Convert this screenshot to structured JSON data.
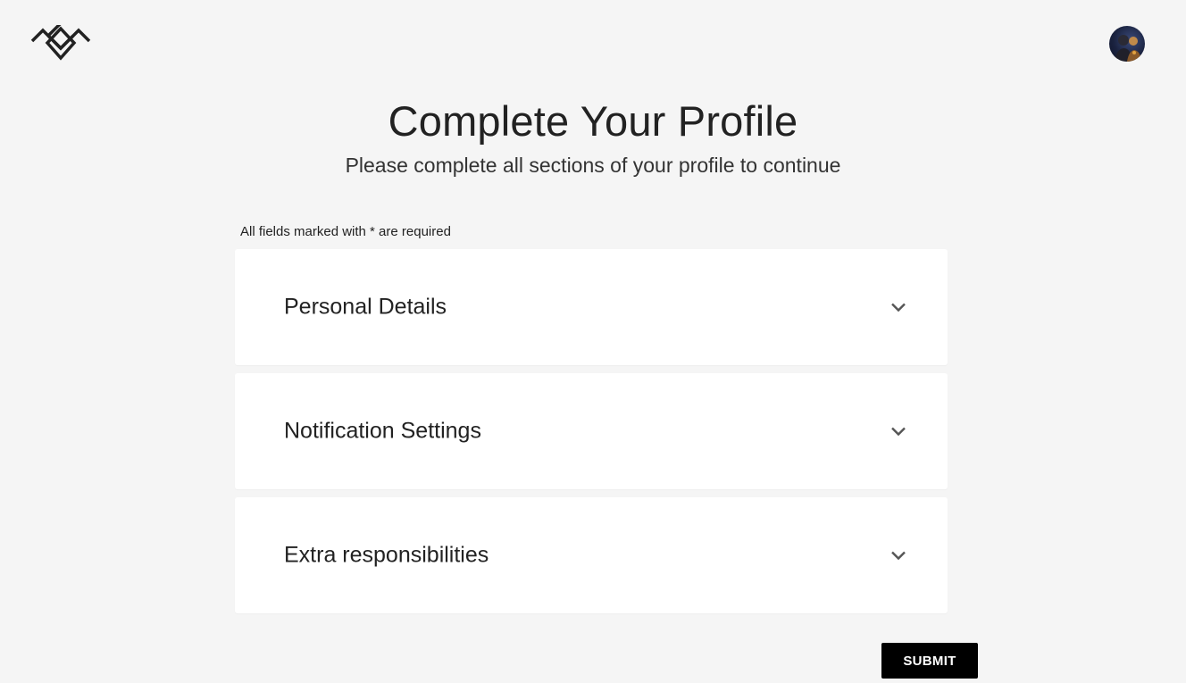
{
  "header": {
    "logo_icon": "mountain-diamond-logo-icon",
    "avatar_icon": "user-avatar-icon"
  },
  "main": {
    "title": "Complete Your Profile",
    "subtitle": "Please complete all sections of your profile to continue",
    "required_note": "All fields marked with * are required",
    "sections": [
      {
        "label": "Personal Details",
        "icon": "chevron-down-icon"
      },
      {
        "label": "Notification Settings",
        "icon": "chevron-down-icon"
      },
      {
        "label": "Extra responsibilities",
        "icon": "chevron-down-icon"
      }
    ],
    "submit_label": "SUBMIT"
  },
  "colors": {
    "background": "#f5f5f5",
    "card": "#ffffff",
    "text": "#222222",
    "button": "#000000",
    "button_text": "#ffffff"
  }
}
